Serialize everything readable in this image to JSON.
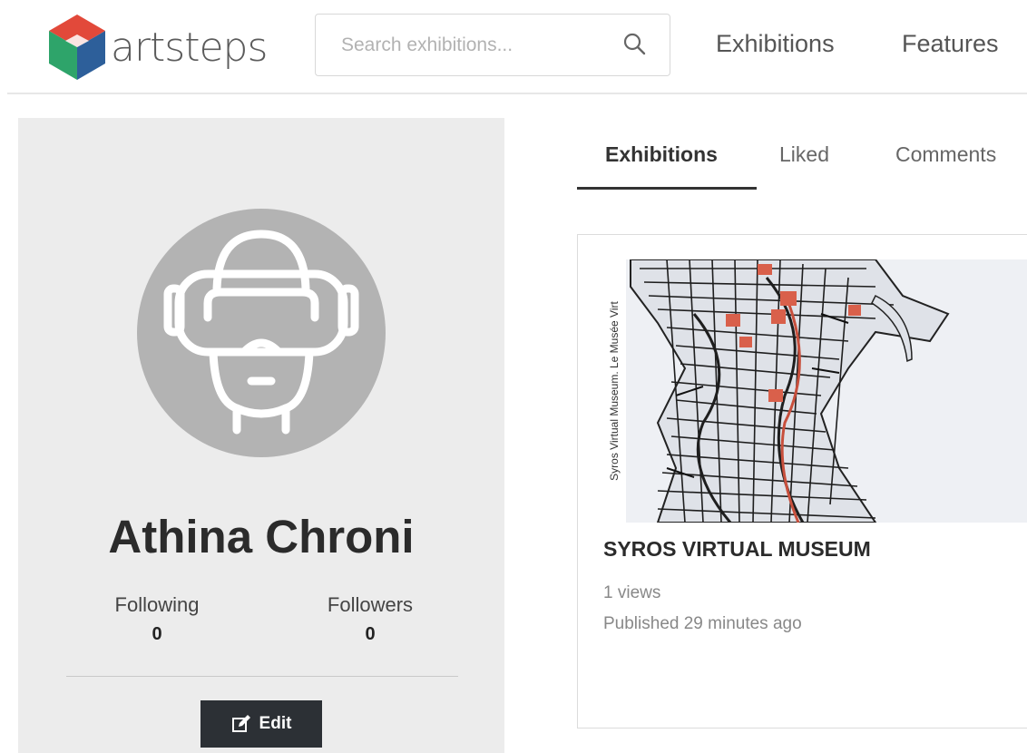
{
  "header": {
    "logo_text": "artsteps",
    "search_placeholder": "Search exhibitions...",
    "search_icon": "search-icon",
    "nav": [
      "Exhibitions",
      "Features"
    ]
  },
  "profile": {
    "avatar_icon": "vr-headset-avatar-icon",
    "name": "Athina Chroni",
    "following_label": "Following",
    "following_count": "0",
    "followers_label": "Followers",
    "followers_count": "0",
    "edit_label": "Edit",
    "edit_icon": "edit-icon"
  },
  "tabs": [
    {
      "label": "Exhibitions",
      "active": true
    },
    {
      "label": "Liked",
      "active": false
    },
    {
      "label": "Comments",
      "active": false
    }
  ],
  "exhibition_card": {
    "image_caption": "Syros Virtual Museum. Le Musée Virt",
    "title": "SYROS VIRTUAL MUSEUM",
    "views": "1 views",
    "published": "Published 29 minutes ago"
  },
  "colors": {
    "sidebar_bg": "#ececec",
    "button_bg": "#2c3035",
    "avatar_bg": "#b3b3b3",
    "logo_red": "#e2493a",
    "logo_green": "#2ea46a",
    "logo_blue": "#2d5f9a"
  }
}
